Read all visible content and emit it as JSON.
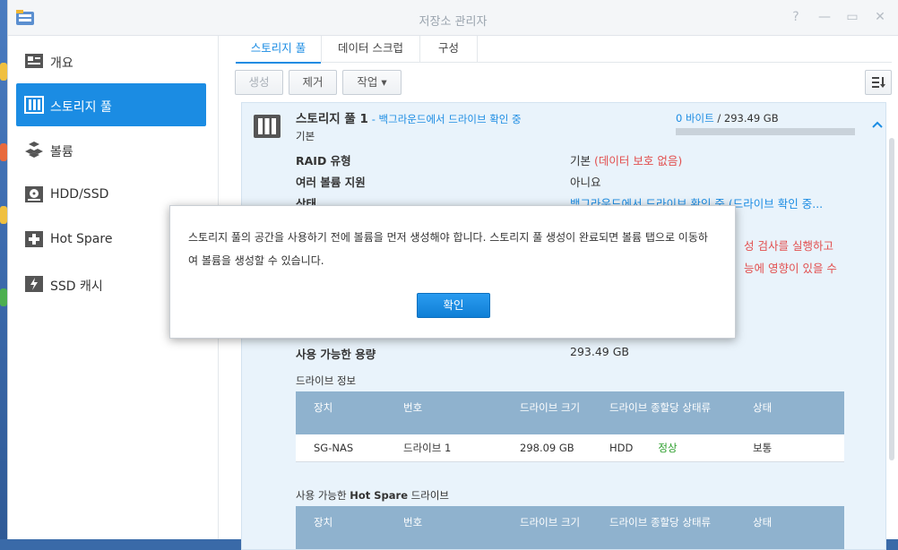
{
  "window": {
    "title": "저장소 관리자",
    "controls": [
      "?",
      "—",
      "▭",
      "✕"
    ]
  },
  "sidebar": {
    "items": [
      {
        "label": "개요",
        "icon": "overview-icon"
      },
      {
        "label": "스토리지 풀",
        "icon": "storage-pool-icon",
        "active": true
      },
      {
        "label": "볼륨",
        "icon": "volume-icon"
      },
      {
        "label": "HDD/SSD",
        "icon": "hdd-icon"
      },
      {
        "label": "Hot Spare",
        "icon": "hot-spare-icon"
      },
      {
        "label": "SSD 캐시",
        "icon": "ssd-cache-icon"
      }
    ]
  },
  "tabs": [
    {
      "label": "스토리지 풀",
      "active": true
    },
    {
      "label": "데이터 스크럽"
    },
    {
      "label": "구성"
    }
  ],
  "toolbar": {
    "create": "생성",
    "remove": "제거",
    "action": "작업 ▾",
    "sort_icon": "sort-icon"
  },
  "pool": {
    "name": "스토리지 풀 1",
    "status_suffix": "- 백그라운드에서 드라이브 확인 중",
    "type": "기본",
    "usage_used": "0 바이트",
    "usage_sep": " / ",
    "usage_total": "293.49 GB",
    "usage_fraction": 0.0,
    "fields": [
      {
        "label": "RAID 유형",
        "value": "기본",
        "value_extra": "(데이터 보호 없음)"
      },
      {
        "label": "여러 볼륨 지원",
        "value": "아니요"
      },
      {
        "label": "상태",
        "value": "백그라운드에서 드라이브 확인 중 (드라이브 확인 중..."
      }
    ],
    "warning_line1": "성 검사를 실행하고",
    "warning_line2": "능에 영향이 있을 수",
    "available_label": "사용 가능한 용량",
    "available_value": "293.49 GB",
    "drive_info_title": "드라이브 정보",
    "drive_table": {
      "headers": [
        "장치",
        "번호",
        "드라이브 크기",
        "드라이브 종할당 상태류",
        "상태"
      ],
      "rows": [
        {
          "device": "SG-NAS",
          "number": "드라이브 1",
          "size": "298.09 GB",
          "type": "HDD",
          "alloc": "정상",
          "status": "보통"
        }
      ]
    },
    "hotspare_title_prefix": "사용 가능한 ",
    "hotspare_title_bold": "Hot Spare",
    "hotspare_title_suffix": " 드라이브",
    "hotspare_headers": [
      "장치",
      "번호",
      "드라이브 크기",
      "드라이브 종할당 상태류",
      "상태"
    ]
  },
  "dialog": {
    "message": "스토리지 풀의 공간을 사용하기 전에 볼륨을 먼저 생성해야 합니다. 스토리지 풀 생성이 완료되면 볼륨 탭으로 이동하여 볼륨을 생성할 수 있습니다.",
    "ok": "확인"
  },
  "colors": {
    "accent": "#1b8ce3",
    "warning": "#e24f4f",
    "ok": "#2a9d2a"
  }
}
